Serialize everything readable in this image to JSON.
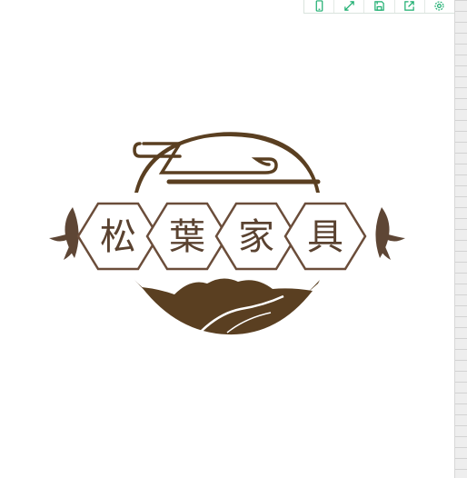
{
  "logo": {
    "text_chars": [
      "松",
      "葉",
      "家",
      "具"
    ],
    "colors": {
      "primary": "#5a3f21",
      "hex_border": "#6b4d3a",
      "text": "#5a4230",
      "leaf": "#5e4635"
    }
  },
  "toolbar": {
    "buttons": [
      {
        "icon": "mobile-preview-icon"
      },
      {
        "icon": "fullscreen-icon"
      },
      {
        "icon": "save-icon"
      },
      {
        "icon": "share-icon"
      },
      {
        "icon": "settings-icon"
      }
    ],
    "accent": "#1aad6e"
  }
}
